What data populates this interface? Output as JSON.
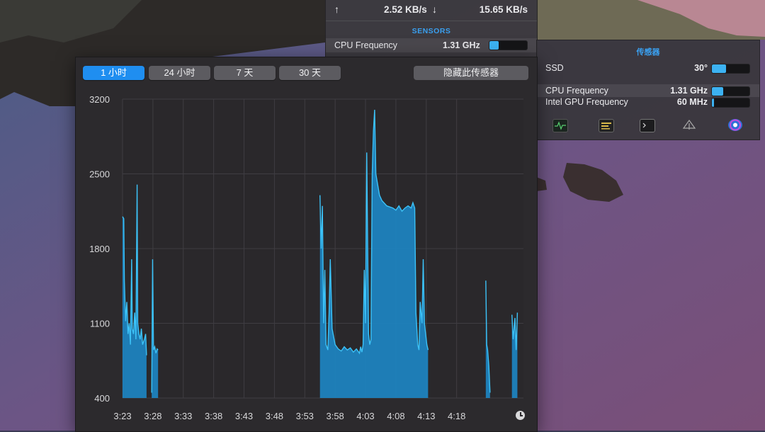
{
  "network": {
    "upload_arrow": "↑",
    "upload": "2.52 KB/s",
    "download_arrow": "↓",
    "download": "15.65 KB/s"
  },
  "top_sensors": {
    "header": "SENSORS",
    "rows": [
      {
        "name": "CPU Frequency",
        "value": "1.31 GHz",
        "level": 0.25
      }
    ]
  },
  "side_sensors": {
    "title": "传感器",
    "rows": [
      {
        "name": "SSD",
        "value": "30°",
        "level": 0.38
      },
      {
        "name": "CPU Frequency",
        "value": "1.31 GHz",
        "level": 0.3
      },
      {
        "name": "Intel GPU Frequency",
        "value": "60 MHz",
        "level": 0.05
      }
    ],
    "icons": [
      "activity-monitor-icon",
      "console-icon",
      "terminal-icon",
      "disk-utility-icon",
      "istat-icon"
    ]
  },
  "graph_window": {
    "ranges": [
      "1 小时",
      "24 小时",
      "7 天",
      "30 天"
    ],
    "active_range": "1 小时",
    "hide_button": "隐藏此传感器"
  },
  "colors": {
    "accent": "#1f8ef0",
    "chart_fill": "#1d86c5",
    "chart_line": "#3cc2f7"
  },
  "chart_data": {
    "type": "area",
    "ylim": [
      400,
      3200
    ],
    "yticks": [
      "3200",
      "2500",
      "1800",
      "1100",
      "400"
    ],
    "xticks": [
      "3:23",
      "3:28",
      "3:33",
      "3:38",
      "3:43",
      "3:48",
      "3:53",
      "3:58",
      "4:03",
      "4:08",
      "4:13",
      "4:18"
    ],
    "series": [
      {
        "segments": [
          [
            [
              0,
              2100
            ],
            [
              0.2,
              2080
            ],
            [
              0.3,
              1500
            ],
            [
              0.5,
              1120
            ],
            [
              0.7,
              1300
            ],
            [
              0.9,
              1000
            ],
            [
              1.1,
              1100
            ],
            [
              1.3,
              900
            ],
            [
              1.5,
              1700
            ],
            [
              1.6,
              1050
            ],
            [
              1.8,
              1000
            ],
            [
              2.0,
              1200
            ],
            [
              2.2,
              950
            ],
            [
              2.4,
              2400
            ],
            [
              2.5,
              1100
            ],
            [
              2.7,
              1000
            ],
            [
              2.9,
              950
            ],
            [
              3.1,
              1050
            ],
            [
              3.3,
              900
            ],
            [
              3.6,
              950
            ],
            [
              3.8,
              1000
            ],
            [
              3.95,
              800
            ]
          ],
          [
            [
              4.8,
              450
            ],
            [
              4.95,
              1700
            ],
            [
              5.1,
              850
            ],
            [
              5.3,
              880
            ],
            [
              5.5,
              820
            ],
            [
              5.7,
              860
            ],
            [
              5.85,
              850
            ]
          ],
          [
            [
              32.5,
              2300
            ],
            [
              32.7,
              1800
            ],
            [
              32.9,
              2200
            ],
            [
              33.1,
              1100
            ],
            [
              33.3,
              1600
            ],
            [
              33.5,
              900
            ],
            [
              33.8,
              850
            ],
            [
              34.0,
              1200
            ],
            [
              34.2,
              1700
            ],
            [
              34.5,
              1050
            ],
            [
              35.0,
              900
            ],
            [
              35.5,
              860
            ],
            [
              36.0,
              840
            ],
            [
              36.5,
              880
            ],
            [
              37.0,
              850
            ],
            [
              37.5,
              870
            ],
            [
              38.0,
              830
            ],
            [
              38.5,
              860
            ],
            [
              39.0,
              820
            ],
            [
              39.2,
              880
            ],
            [
              39.4,
              830
            ],
            [
              39.6,
              900
            ],
            [
              39.8,
              1600
            ],
            [
              40.0,
              1100
            ],
            [
              40.2,
              2700
            ],
            [
              40.5,
              1000
            ],
            [
              40.7,
              900
            ],
            [
              40.9,
              950
            ],
            [
              41.1,
              2500
            ],
            [
              41.3,
              2900
            ],
            [
              41.5,
              3100
            ],
            [
              41.7,
              2500
            ],
            [
              42.0,
              2400
            ],
            [
              42.3,
              2300
            ],
            [
              42.7,
              2250
            ],
            [
              43.5,
              2200
            ],
            [
              44.5,
              2180
            ],
            [
              45.0,
              2160
            ],
            [
              45.5,
              2200
            ],
            [
              46.0,
              2150
            ],
            [
              46.5,
              2180
            ],
            [
              47.0,
              2200
            ],
            [
              47.5,
              2180
            ],
            [
              47.8,
              2230
            ],
            [
              48.1,
              2180
            ],
            [
              48.3,
              1200
            ],
            [
              48.6,
              900
            ],
            [
              48.8,
              850
            ],
            [
              49.0,
              1300
            ],
            [
              49.3,
              1100
            ],
            [
              49.5,
              1700
            ],
            [
              49.7,
              1100
            ],
            [
              49.9,
              1000
            ],
            [
              50.1,
              900
            ],
            [
              50.3,
              850
            ]
          ],
          [
            [
              59.8,
              1500
            ],
            [
              59.95,
              900
            ],
            [
              60.1,
              850
            ],
            [
              60.3,
              700
            ],
            [
              60.5,
              450
            ]
          ],
          [
            [
              64.1,
              1180
            ],
            [
              64.3,
              950
            ],
            [
              64.6,
              1150
            ],
            [
              64.8,
              850
            ],
            [
              65.0,
              1200
            ]
          ]
        ]
      }
    ]
  }
}
